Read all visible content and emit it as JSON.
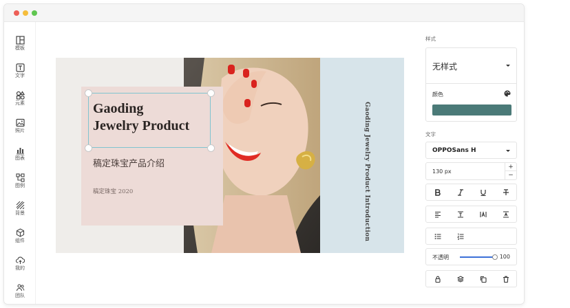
{
  "window": {
    "controls": [
      "close",
      "minimize",
      "maximize"
    ],
    "colors": {
      "close": "#ed5f57",
      "minimize": "#f5bd3b",
      "maximize": "#5fc650"
    }
  },
  "sidebar": {
    "items": [
      {
        "label": "模板",
        "icon": "template-icon"
      },
      {
        "label": "文字",
        "icon": "text-icon"
      },
      {
        "label": "元素",
        "icon": "elements-icon"
      },
      {
        "label": "照片",
        "icon": "photo-icon"
      },
      {
        "label": "图表",
        "icon": "chart-icon"
      },
      {
        "label": "图例",
        "icon": "diagram-icon"
      },
      {
        "label": "背景",
        "icon": "background-icon"
      },
      {
        "label": "组件",
        "icon": "component-icon"
      },
      {
        "label": "我的",
        "icon": "cloud-upload-icon"
      },
      {
        "label": "团队",
        "icon": "team-icon"
      }
    ]
  },
  "slide": {
    "title_line1": "Gaoding",
    "title_line2": "Jewelry Product",
    "subtitle": "稿定珠宝产品介绍",
    "brand_year": "稿定珠宝 2020",
    "vertical_text": "Gaoding Jewelry Product Introduction",
    "colors": {
      "background": "#efedea",
      "card": "#eddbd7",
      "band": "#d7e4ea"
    }
  },
  "panel": {
    "style_section_label": "样式",
    "style_value": "无样式",
    "color_label": "颜色",
    "color_value": "#4b7a78",
    "text_section_label": "文字",
    "font_value": "OPPOSans H",
    "size_value": "130 px",
    "stepper_plus": "+",
    "stepper_minus": "−",
    "opacity_label": "不透明",
    "opacity_value": "100",
    "opacity_fraction": 1.0,
    "format_buttons": [
      "bold-icon",
      "italic-icon",
      "underline-icon",
      "strikethrough-icon"
    ],
    "spacing_buttons": [
      "align-icon",
      "line-height-icon",
      "letter-spacing-icon",
      "paragraph-spacing-icon"
    ],
    "list_buttons": [
      "unordered-list-icon",
      "ordered-list-icon"
    ],
    "action_buttons": [
      "lock-icon",
      "layers-icon",
      "copy-icon",
      "delete-icon"
    ],
    "accent_color": "#3a6fd8"
  }
}
